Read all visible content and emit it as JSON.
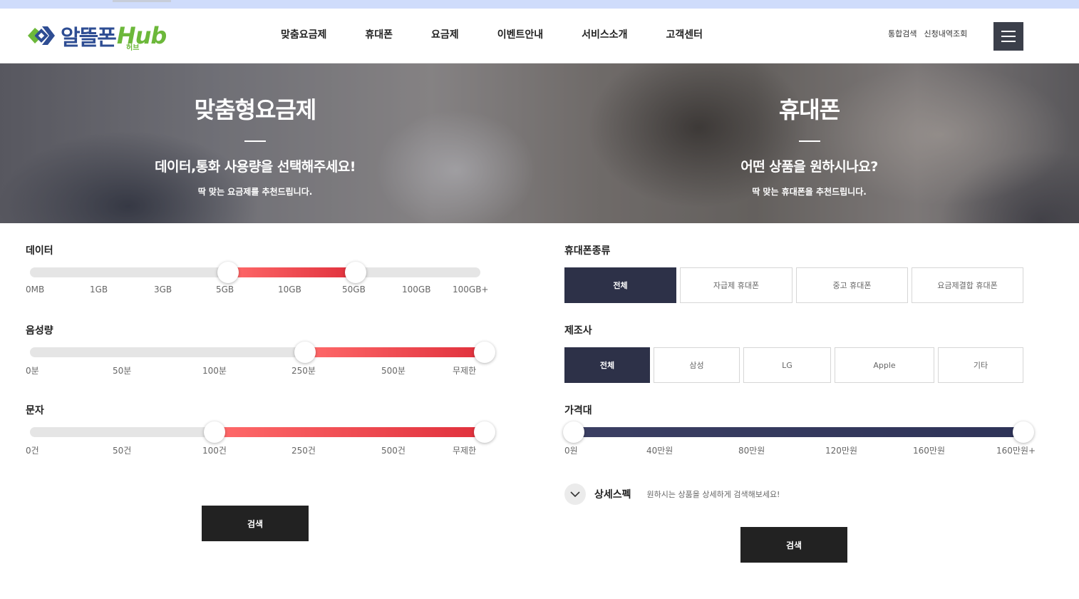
{
  "logo": {
    "name": "알뜰폰",
    "hub": "Hub",
    "sub": "허브"
  },
  "nav": [
    "맞춤요금제",
    "휴대폰",
    "요금제",
    "이벤트안내",
    "서비스소개",
    "고객센터"
  ],
  "util": {
    "search": "통합검색",
    "order_lookup": "신청내역조회"
  },
  "hero": {
    "left": {
      "title": "맞춤형요금제",
      "subtitle": "데이터,통화 사용량을 선택해주세요!",
      "desc": "딱 맞는 요금제를 추천드립니다."
    },
    "right": {
      "title": "휴대폰",
      "subtitle": "어떤 상품을 원하시나요?",
      "desc": "딱 맞는 휴대폰을 추천드립니다."
    }
  },
  "plan": {
    "data": {
      "label": "데이터",
      "ticks": [
        "0MB",
        "1GB",
        "3GB",
        "5GB",
        "10GB",
        "50GB",
        "100GB",
        "100GB+"
      ],
      "range": [
        "5GB",
        "50GB"
      ]
    },
    "voice": {
      "label": "음성량",
      "ticks": [
        "0분",
        "50분",
        "100분",
        "250분",
        "500분",
        "무제한"
      ],
      "range": [
        "250분",
        "무제한"
      ]
    },
    "sms": {
      "label": "문자",
      "ticks": [
        "0건",
        "50건",
        "100건",
        "250건",
        "500건",
        "무제한"
      ],
      "range": [
        "100건",
        "무제한"
      ]
    },
    "search_label": "검색"
  },
  "phone": {
    "type": {
      "label": "휴대폰종류",
      "options": [
        "전체",
        "자급제 휴대폰",
        "중고 휴대폰",
        "요금제결합 휴대폰"
      ],
      "selected": "전체"
    },
    "maker": {
      "label": "제조사",
      "options": [
        "전체",
        "삼성",
        "LG",
        "Apple",
        "기타"
      ],
      "selected": "전체"
    },
    "price": {
      "label": "가격대",
      "ticks": [
        "0원",
        "40만원",
        "80만원",
        "120만원",
        "160만원",
        "160만원+"
      ],
      "range": [
        "0원",
        "160만원+"
      ]
    },
    "detail": {
      "label": "상세스펙",
      "hint": "원하시는 상품을 상세하게 검색해보세요!"
    },
    "search_label": "검색"
  },
  "colors": {
    "accent_red": "#e0303c",
    "navy": "#2d3148",
    "logo_blue": "#2e4d93",
    "logo_green": "#6cb83a"
  }
}
